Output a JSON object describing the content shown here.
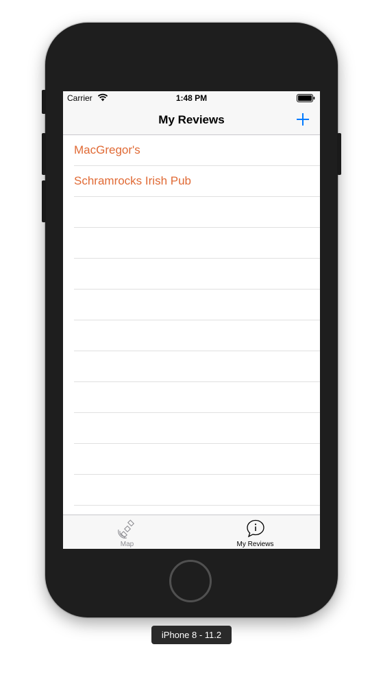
{
  "status_bar": {
    "carrier": "Carrier",
    "time": "1:48 PM",
    "icons": [
      "wifi-icon",
      "battery-icon"
    ]
  },
  "nav_bar": {
    "title": "My Reviews",
    "add_icon": "plus-icon",
    "accent_color": "#007aff"
  },
  "reviews": {
    "items": [
      {
        "label": "MacGregor's"
      },
      {
        "label": "Schramrocks Irish Pub"
      }
    ],
    "label_color": "#e06a35"
  },
  "tab_bar": {
    "tabs": [
      {
        "label": "Map",
        "icon": "satellite-icon",
        "selected": false
      },
      {
        "label": "My Reviews",
        "icon": "info-speech-bubble-icon",
        "selected": true
      }
    ]
  },
  "device": {
    "label": "iPhone 8 - 11.2"
  }
}
